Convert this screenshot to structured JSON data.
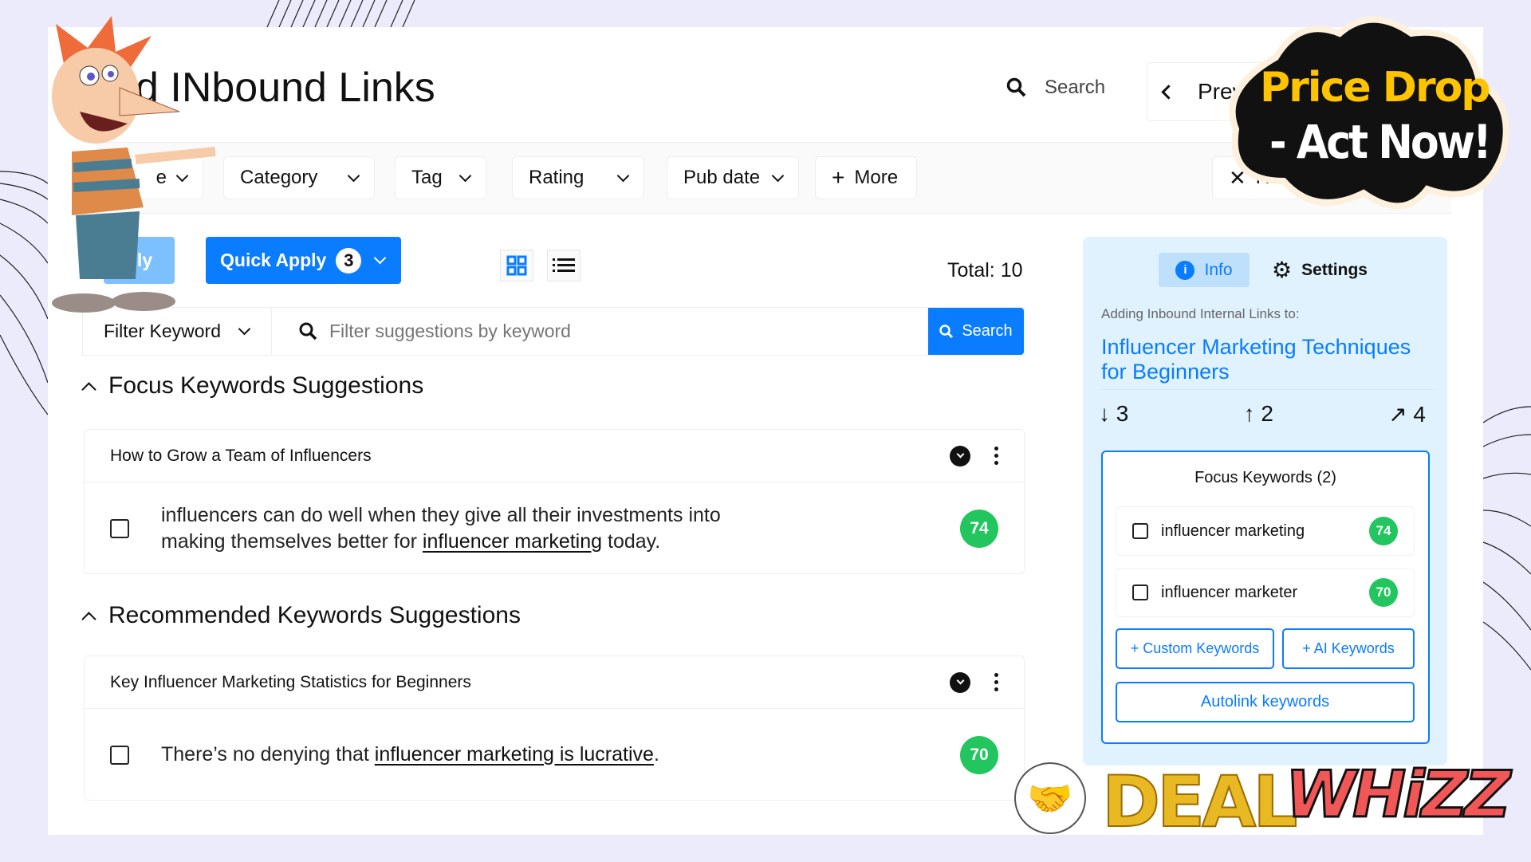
{
  "header": {
    "title": "d INbound Links",
    "search_label": "Search",
    "prev_label": "Prev"
  },
  "filters": {
    "partial_label": "e",
    "items": [
      "Category",
      "Tag",
      "Rating",
      "Pub date"
    ],
    "more_label": "More",
    "reset_label": "Re"
  },
  "actions": {
    "apply_label": "ply",
    "quick_apply_label": "Quick Apply",
    "quick_apply_count": "3",
    "total_label": "Total: 10"
  },
  "keyword_filter": {
    "dropdown_label": "Filter Keyword",
    "placeholder": "Filter suggestions by keyword",
    "search_button": "Search"
  },
  "sections": [
    {
      "title": "Focus Keywords Suggestions",
      "items": [
        {
          "post_title": "How to Grow a Team of Influencers",
          "text_before": "influencers can do well when they give all their investments into making themselves better for ",
          "link_text": "influencer marketing",
          "text_after": " today.",
          "score": "74"
        }
      ]
    },
    {
      "title": "Recommended Keywords Suggestions",
      "items": [
        {
          "post_title": "Key Influencer Marketing Statistics for Beginners",
          "text_before": "There’s no denying that ",
          "link_text": "influencer marketing is lucrative",
          "text_after": ".",
          "score": "70"
        }
      ]
    }
  ],
  "panel": {
    "tabs": [
      {
        "label": "Info",
        "active": true
      },
      {
        "label": "Settings",
        "active": false
      }
    ],
    "adding_label": "Adding Inbound Internal Links to:",
    "target_title": "Influencer Marketing Techniques for Beginners",
    "stats": {
      "inbound": "3",
      "outbound": "2",
      "external": "4"
    },
    "focus_keywords_title": "Focus Keywords (2)",
    "keywords": [
      {
        "label": "influencer marketing",
        "score": "74"
      },
      {
        "label": "influencer marketer",
        "score": "70"
      }
    ],
    "custom_keywords_button": "+ Custom Keywords",
    "ai_keywords_button": "+ AI Keywords",
    "autolink_button": "Autolink keywords"
  },
  "promo": {
    "headline_1": "Price Drop",
    "headline_2": "- Act Now!",
    "logo_1": "DEAL",
    "logo_2": "WHiZZ"
  },
  "colors": {
    "accent": "#0a7cff",
    "score_green": "#22c55e",
    "panel_bg": "#e0f2fe",
    "promo_yellow": "#ffc400"
  }
}
